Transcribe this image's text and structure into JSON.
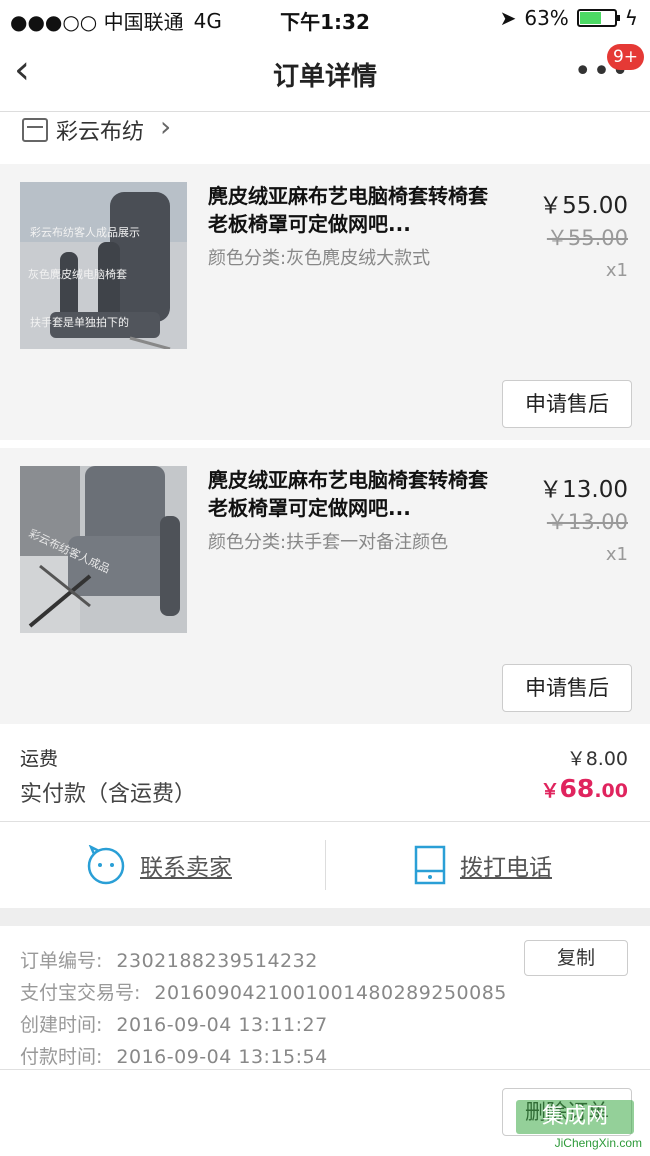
{
  "status_bar": {
    "carrier": "●●●○○ 中国联通",
    "network": "4G",
    "time": "下午1:32",
    "battery": "63%",
    "battery_level": 0.63
  },
  "nav": {
    "back_icon": "chevron-left-icon",
    "title": "订单详情",
    "more_icon": "more-dots-icon",
    "badge": "9+"
  },
  "shop": {
    "name": "彩云布纺"
  },
  "items": [
    {
      "title": "麂皮绒亚麻布艺电脑椅套转椅套老板椅罩可定做网吧...",
      "spec": "颜色分类:灰色麂皮绒大款式",
      "price": "￥55.00",
      "original_price": "￥55.00",
      "quantity": "x1",
      "after_sale_label": "申请售后",
      "thumb_text": [
        "彩云布纺客人成品展示",
        "灰色麂皮绒电脑椅套",
        "扶手套是单独拍下的"
      ]
    },
    {
      "title": "麂皮绒亚麻布艺电脑椅套转椅套老板椅罩可定做网吧...",
      "spec": "颜色分类:扶手套一对备注颜色",
      "price": "￥13.00",
      "original_price": "￥13.00",
      "quantity": "x1",
      "after_sale_label": "申请售后",
      "thumb_text": [
        "彩云布纺客人成品"
      ]
    }
  ],
  "totals": {
    "shipping_label": "运费",
    "shipping_value": "￥8.00",
    "paid_label": "实付款（含运费）",
    "paid_currency": "￥",
    "paid_int": "68",
    "paid_dec": ".00",
    "accent_color": "#e0245e"
  },
  "contact": {
    "seller_label": "联系卖家",
    "seller_icon": "chat-face-icon",
    "phone_label": "拨打电话",
    "phone_icon": "phone-icon",
    "icon_color": "#2a9fd6"
  },
  "order_info": {
    "order_no_label": "订单编号:",
    "order_no": "2302188239514232",
    "copy_label": "复制",
    "alipay_label": "支付宝交易号:",
    "alipay_no": "2016090421001001480289250085",
    "created_label": "创建时间:",
    "created_time": "2016-09-04 13:11:27",
    "paid_label": "付款时间:",
    "paid_time": "2016-09-04 13:15:54"
  },
  "footer": {
    "delete_label": "删除订单"
  },
  "watermark": {
    "logo_text": "集成网",
    "url": "JiChengXin.com"
  }
}
